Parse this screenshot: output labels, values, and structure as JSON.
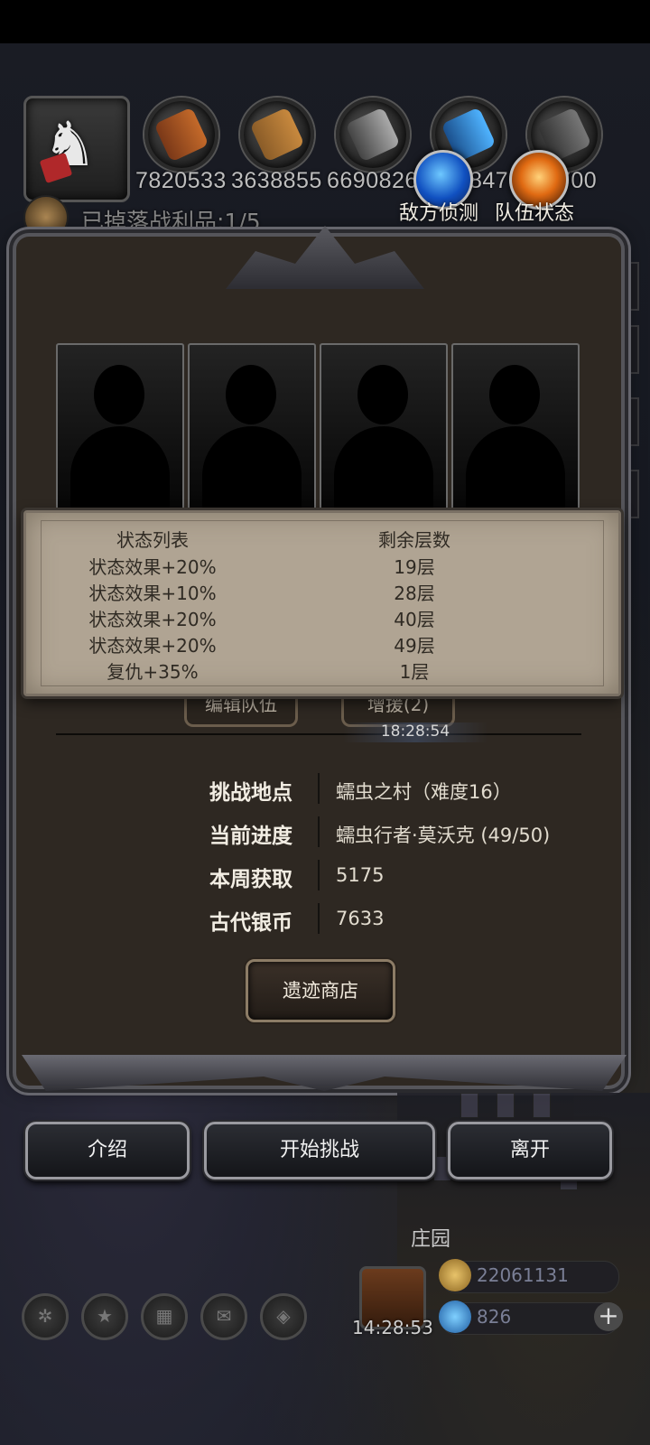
{
  "resources": {
    "values": [
      "7820533",
      "3638855",
      "6690826",
      "847",
      "700"
    ],
    "icons": [
      "wood-icon",
      "plank-icon",
      "iron-icon",
      "crystal-icon",
      "stone-icon"
    ]
  },
  "loot": {
    "text": "已掉落战利品:1/5"
  },
  "orbs": {
    "scout_label": "敌方侦测",
    "team_label": "队伍状态"
  },
  "status_table": {
    "headers": [
      "状态列表",
      "剩余层数"
    ],
    "rows": [
      [
        "状态效果+20%",
        "19层"
      ],
      [
        "状态效果+10%",
        "28层"
      ],
      [
        "状态效果+20%",
        "40层"
      ],
      [
        "状态效果+20%",
        "49层"
      ],
      [
        "复仇+35%",
        "1层"
      ]
    ]
  },
  "team": {
    "edit_label": "编辑队伍",
    "reinforce_label": "增援(2)",
    "timer": "18:28:54"
  },
  "info": {
    "location_label": "挑战地点",
    "location_value": "蠕虫之村（难度16）",
    "progress_label": "当前进度",
    "progress_value": "蠕虫行者·莫沃克 (49/50)",
    "weekly_label": "本周获取",
    "weekly_value": "5175",
    "coin_label": "古代银币",
    "coin_value": "7633"
  },
  "shop_label": "遗迹商店",
  "actions": {
    "intro": "介绍",
    "start": "开始挑战",
    "leave": "离开"
  },
  "bottom": {
    "manor_label": "庄园",
    "gift_time": "14:28:53",
    "gold": "22061131",
    "gems": "826"
  },
  "colors": {
    "popup_bg": "#b0a493",
    "panel_bg": "#2e2822",
    "button_border": "#9a9aa0"
  }
}
